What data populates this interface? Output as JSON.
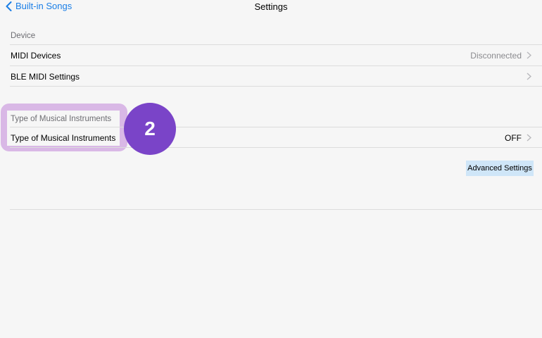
{
  "navbar": {
    "back_label": "Built-in Songs",
    "title": "Settings",
    "accent_color": "#1a7ee6"
  },
  "device_section": {
    "header": "Device",
    "rows": [
      {
        "label": "MIDI Devices",
        "detail": "Disconnected"
      },
      {
        "label": "BLE MIDI Settings",
        "detail": ""
      }
    ]
  },
  "instrument_section": {
    "header": "Type of Musical Instruments",
    "row": {
      "label": "Type of Musical Instruments",
      "detail": "OFF"
    }
  },
  "advanced_button": {
    "label": "Advanced Settings",
    "color": "#cfe6f8"
  },
  "annotation": {
    "step": "2",
    "badge_color": "#7a44c8",
    "highlight_color": "#d9b8e6"
  }
}
